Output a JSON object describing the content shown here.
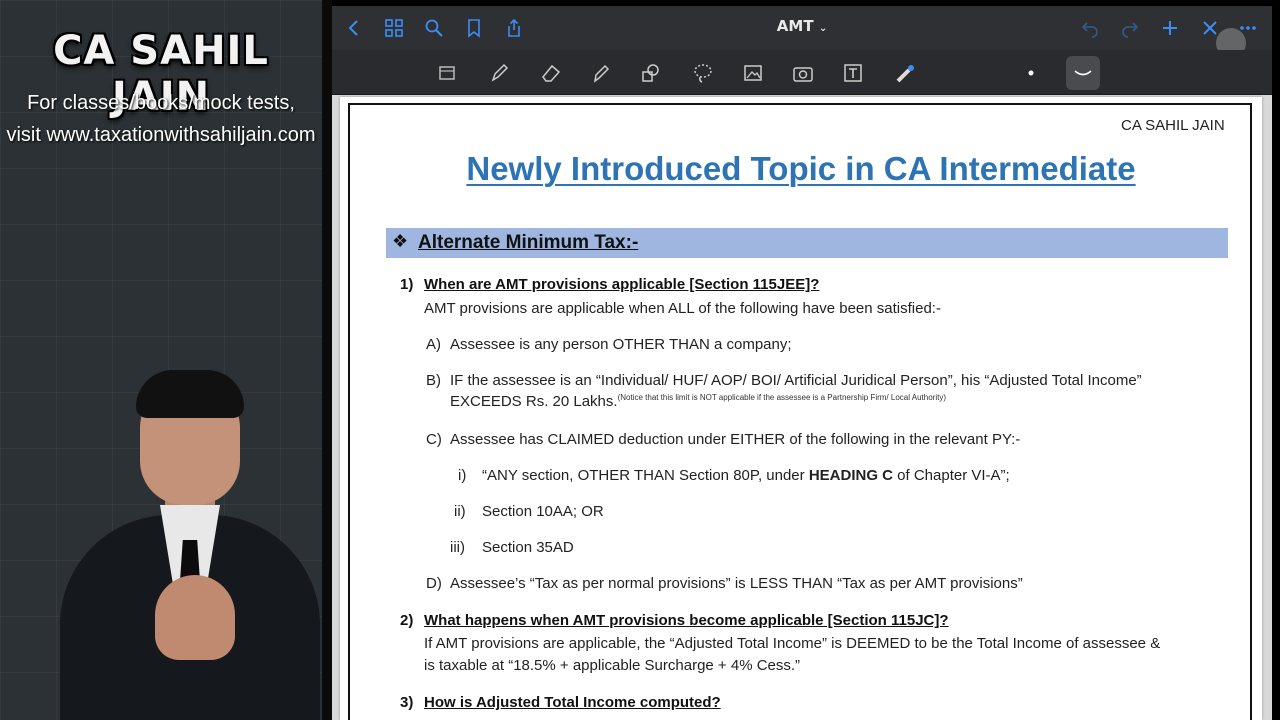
{
  "presenter": {
    "name": "CA SAHIL JAIN",
    "line1": "For classes/books/mock tests,",
    "line2": "visit www.taxationwithsahiljain.com"
  },
  "app": {
    "title": "AMT",
    "accent": "#3a8ef6"
  },
  "toolbar": {
    "tools": [
      "page-icon",
      "pen-icon",
      "eraser-icon",
      "highlighter-icon",
      "shapes-icon",
      "lasso-icon",
      "image-icon",
      "camera-icon",
      "text-icon",
      "laser-icon",
      "dot-icon",
      "curve-icon"
    ]
  },
  "document": {
    "author": "CA SAHIL JAIN",
    "heading": "Newly Introduced Topic in CA Intermediate",
    "section_symbol": "❖",
    "section_title": "Alternate Minimum Tax:-",
    "q1": {
      "num": "1)",
      "title": "When are AMT provisions applicable [Section 115JEE]?",
      "intro": "AMT provisions are applicable when ALL of the following have been satisfied:-",
      "a_label": "A)",
      "a": "Assessee is any person OTHER THAN a company;",
      "b_label": "B)",
      "b_line1": "IF the assessee is an “Individual/ HUF/ AOP/ BOI/ Artificial Juridical Person”, his “Adjusted Total Income”",
      "b_line2": "EXCEEDS Rs. 20 Lakhs.",
      "b_note": "(Notice that this limit is NOT applicable if the assessee is a Partnership Firm/ Local Authority)",
      "c_label": "C)",
      "c": "Assessee has CLAIMED deduction under EITHER of the following in the relevant PY:-",
      "ci_label": "i)",
      "ci_pre": "“ANY section, OTHER THAN Section 80P, under ",
      "ci_bold": "HEADING C",
      "ci_post": " of Chapter VI-A”;",
      "cii_label": "ii)",
      "cii": "Section 10AA; OR",
      "ciii_label": "iii)",
      "ciii": "Section 35AD",
      "d_label": "D)",
      "d": "Assessee’s “Tax as per normal provisions” is LESS THAN “Tax as per AMT provisions”"
    },
    "q2": {
      "num": "2)",
      "title": "What happens when AMT provisions become applicable [Section 115JC]?",
      "line1": "If AMT provisions are applicable, the “Adjusted Total Income” is DEEMED to be the Total Income of assessee &",
      "line2": "is taxable at “18.5% + applicable Surcharge + 4% Cess.”"
    },
    "q3": {
      "num": "3)",
      "title": "How is Adjusted Total Income computed?"
    }
  }
}
